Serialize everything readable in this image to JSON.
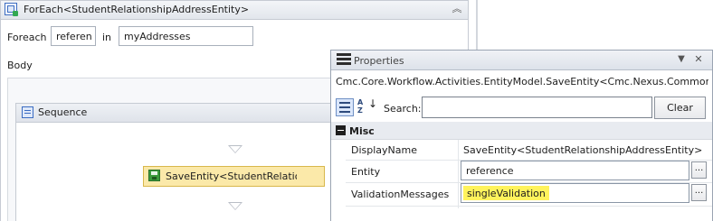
{
  "designer": {
    "foreach": {
      "title": "ForEach<StudentRelationshipAddressEntity>",
      "foreach_label": "Foreach",
      "item_variable": "referen",
      "in_label": "in",
      "values": "myAddresses",
      "body_label": "Body",
      "collapse_icon": "double-chevron-up-icon"
    },
    "sequence": {
      "title": "Sequence",
      "activity_label": "SaveEntity<StudentRelatior"
    }
  },
  "properties": {
    "title": "Properties",
    "type_name": "Cmc.Core.Workflow.Activities.EntityModel.SaveEntity<Cmc.Nexus.Common....",
    "search_label": "Search:",
    "search_value": "",
    "clear_label": "Clear",
    "category": "Misc",
    "rows": [
      {
        "name": "DisplayName",
        "value": "SaveEntity<StudentRelationshipAddressEntity>"
      },
      {
        "name": "Entity",
        "value": "reference"
      },
      {
        "name": "ValidationMessages",
        "value": "singleValidation"
      }
    ],
    "ellipsis": "..."
  },
  "colors": {
    "activity_highlight": "#fbe9a9",
    "validation_highlight": "#fff35c",
    "header_gradient_top": "#f3f5f8"
  }
}
